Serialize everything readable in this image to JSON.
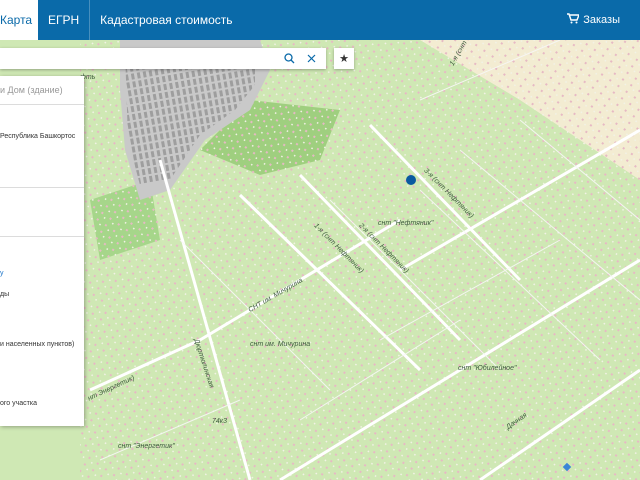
{
  "header": {
    "tabs": [
      {
        "label": "Карта"
      },
      {
        "label": "ЕГРН"
      },
      {
        "label": "Кадастровая стоимость"
      }
    ],
    "orders_label": "Заказы"
  },
  "panel": {
    "title": "и Дом (здание)",
    "address": "Республика Башкортос",
    "link": "у",
    "line1": "ды",
    "line2": "и населенных пунктов)",
    "line3": "ого участка"
  },
  "map_labels": {
    "snt_neftyanik": "снт \"Нефтяник\"",
    "street_1": "1-я (снт Нефтяник)",
    "street_2": "2-я (снт Нефтяник)",
    "street_3": "3-я (снт Нефтяник)",
    "snt_michurina_street": "СНТ им. Мичурина",
    "snt_michurina": "снт им. Мичурина",
    "snt_yubileynoe": "снт \"Юбилейное\"",
    "snt_energetik": "снт \"Энергетик\"",
    "energetik_street": "нт Энергетик)",
    "dyurtyulinskaya": "Дюртюлинская",
    "dachnaya": "Дачная",
    "ufa_fragment": "фть",
    "top_street": "1-я (снт",
    "house_number": "74к3"
  },
  "colors": {
    "header": "#0a6aa9",
    "map_green": "#cfe8b4",
    "built_area": "#bdbdbd",
    "marker": "#0a5aa0",
    "link": "#1a73c7"
  }
}
